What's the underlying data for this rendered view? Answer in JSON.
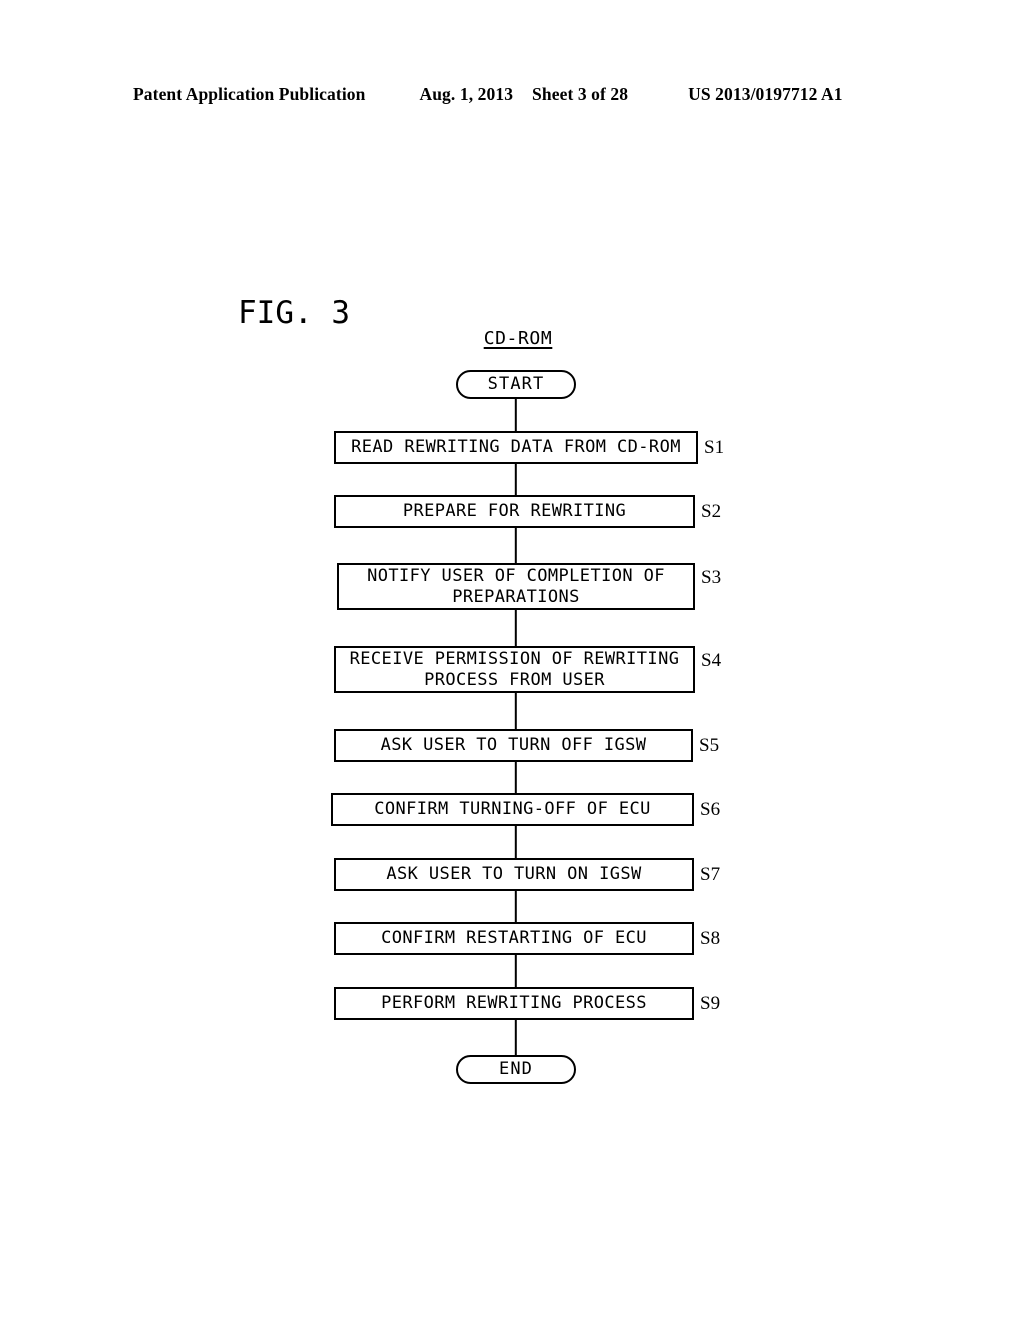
{
  "header": {
    "publication": "Patent Application Publication",
    "date": "Aug. 1, 2013",
    "sheet": "Sheet 3 of 28",
    "patent_number": "US 2013/0197712 A1"
  },
  "figure": {
    "label": "FIG. 3",
    "chart_title": "CD-ROM"
  },
  "flowchart": {
    "start_label": "START",
    "end_label": "END",
    "steps": [
      {
        "id": "S1",
        "text": "READ REWRITING DATA FROM CD-ROM"
      },
      {
        "id": "S2",
        "text": "PREPARE FOR REWRITING"
      },
      {
        "id": "S3",
        "text": "NOTIFY USER OF COMPLETION OF\nPREPARATIONS"
      },
      {
        "id": "S4",
        "text": "RECEIVE PERMISSION OF REWRITING\nPROCESS FROM USER"
      },
      {
        "id": "S5",
        "text": "ASK USER TO TURN OFF IGSW"
      },
      {
        "id": "S6",
        "text": "CONFIRM TURNING-OFF OF ECU"
      },
      {
        "id": "S7",
        "text": "ASK USER TO TURN ON IGSW"
      },
      {
        "id": "S8",
        "text": "CONFIRM RESTARTING OF ECU"
      },
      {
        "id": "S9",
        "text": "PERFORM REWRITING PROCESS"
      }
    ]
  },
  "colors": {
    "ink": "#000000",
    "paper": "#ffffff"
  }
}
